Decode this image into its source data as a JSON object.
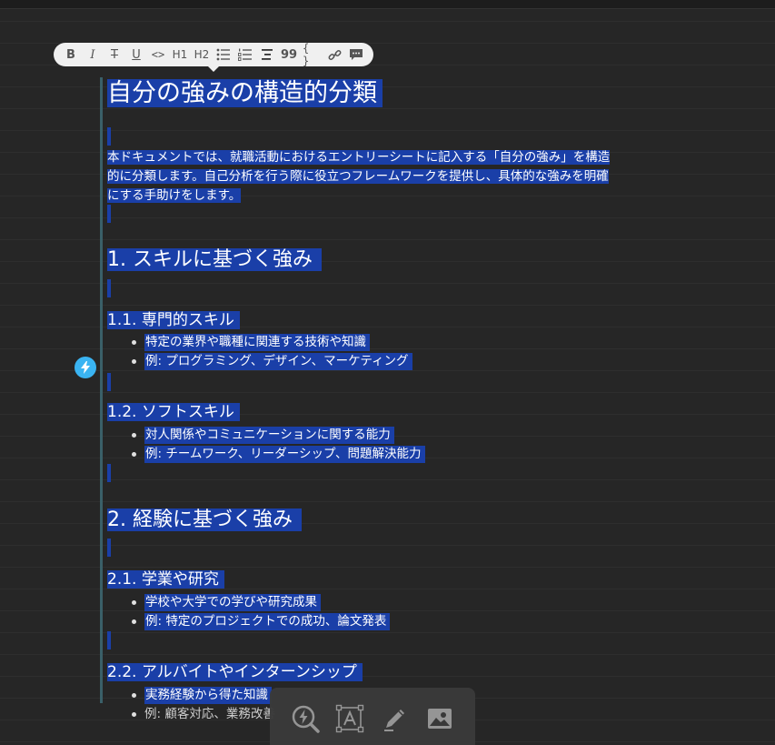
{
  "toolbar": {
    "bold": "B",
    "italic": "I",
    "strike": "T",
    "underline": "U",
    "code": "<>",
    "h1": "H1",
    "h2": "H2",
    "blockquote": "99",
    "codeblock": "{ }"
  },
  "doc": {
    "title": "自分の強みの構造的分類",
    "intro_line1": "本ドキュメントでは、就職活動におけるエントリーシートに記入する「自分の強み」を構造",
    "intro_line2": "的に分類します。自己分析を行う際に役立つフレームワークを提供し、具体的な強みを明確",
    "intro_line3": "にする手助けをします。",
    "sections": [
      {
        "heading": "1. スキルに基づく強み",
        "subsections": [
          {
            "heading": "1.1. 専門的スキル",
            "items": [
              "特定の業界や職種に関連する技術や知識",
              "例: プログラミング、デザイン、マーケティング"
            ]
          },
          {
            "heading": "1.2. ソフトスキル",
            "items": [
              "対人関係やコミュニケーションに関する能力",
              "例: チームワーク、リーダーシップ、問題解決能力"
            ]
          }
        ]
      },
      {
        "heading": "2. 経験に基づく強み",
        "subsections": [
          {
            "heading": "2.1. 学業や研究",
            "items": [
              "学校や大学での学びや研究成果",
              "例: 特定のプロジェクトでの成功、論文発表"
            ]
          },
          {
            "heading": "2.2. アルバイトやインターンシップ",
            "items": [
              "実務経験から得た知識",
              "例: 顧客対応、業務改善"
            ]
          }
        ]
      }
    ]
  },
  "colors": {
    "selection": "#1a3fa8",
    "accent_badge": "#3ab4f2",
    "background": "#262626"
  }
}
